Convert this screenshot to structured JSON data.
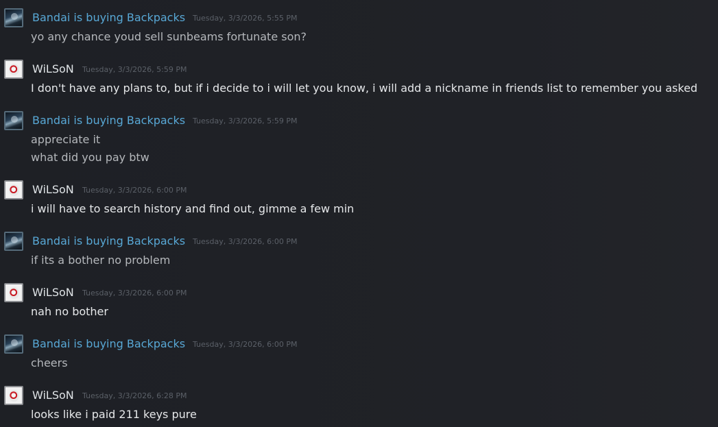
{
  "messages": [
    {
      "sender": "Bandai is buying Backpacks",
      "timestamp": "Tuesday, 3/3/2026, 5:55 PM",
      "lines": [
        "yo any chance youd sell sunbeams fortunate son?"
      ]
    },
    {
      "sender": "WiLSoN",
      "timestamp": "Tuesday, 3/3/2026, 5:59 PM",
      "lines": [
        "I don't have any plans to, but if i decide to i will let you know, i will add a nickname in friends list to remember you asked"
      ]
    },
    {
      "sender": "Bandai is buying Backpacks",
      "timestamp": "Tuesday, 3/3/2026, 5:59 PM",
      "lines": [
        "appreciate it",
        "what did you pay btw"
      ]
    },
    {
      "sender": "WiLSoN",
      "timestamp": "Tuesday, 3/3/2026, 6:00 PM",
      "lines": [
        "i will have to search history and find out, gimme a few min"
      ]
    },
    {
      "sender": "Bandai is buying Backpacks",
      "timestamp": "Tuesday, 3/3/2026, 6:00 PM",
      "lines": [
        "if its a bother no problem"
      ]
    },
    {
      "sender": "WiLSoN",
      "timestamp": "Tuesday, 3/3/2026, 6:00 PM",
      "lines": [
        "nah no bother"
      ]
    },
    {
      "sender": "Bandai is buying Backpacks",
      "timestamp": "Tuesday, 3/3/2026, 6:00 PM",
      "lines": [
        "cheers"
      ]
    },
    {
      "sender": "WiLSoN",
      "timestamp": "Tuesday, 3/3/2026, 6:28 PM",
      "lines": [
        "looks like i paid 211 keys pure"
      ]
    }
  ],
  "colors": {
    "background": "#1f2126",
    "bandai_name": "#58a8d6",
    "wilson_name": "#dfe3e6",
    "timestamp": "#5b6068",
    "bandai_text": "#b5b8bc",
    "wilson_text": "#e6e8ea"
  },
  "icons": {
    "bandai_avatar": "user-avatar-icon",
    "wilson_avatar": "volleyball-avatar-icon"
  }
}
